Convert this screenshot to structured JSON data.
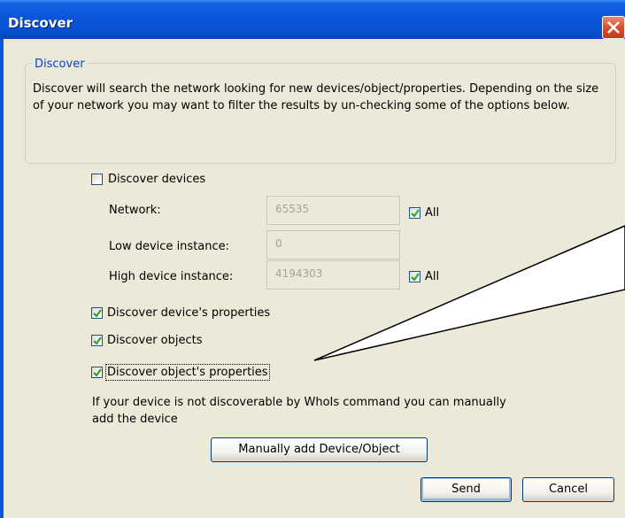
{
  "window": {
    "title": "Discover"
  },
  "group": {
    "legend": "Discover",
    "description": "Discover will search the network looking for new devices/object/properties. Depending on the size of your network you may want to filter the results by un-checking some of the options below."
  },
  "options": {
    "discover_devices": {
      "label": "Discover devices",
      "checked": false
    },
    "network": {
      "label": "Network:",
      "value": "65535",
      "all_label": "All",
      "all_checked": true
    },
    "low_instance": {
      "label": "Low device instance:",
      "value": "0"
    },
    "high_instance": {
      "label": "High device instance:",
      "value": "4194303",
      "all_label": "All",
      "all_checked": true
    },
    "device_properties": {
      "label": "Discover device's properties",
      "checked": true
    },
    "objects": {
      "label": "Discover objects",
      "checked": true
    },
    "object_properties": {
      "label": "Discover object's properties",
      "checked": true
    }
  },
  "manual": {
    "note_line1": "If your device is not discoverable by WhoIs command you can manually",
    "note_line2": "add the device",
    "button_label": "Manually add Device/Object"
  },
  "footer": {
    "send_label": "Send",
    "cancel_label": "Cancel"
  },
  "colors": {
    "titlebar": "#0a55d8",
    "dialog_bg": "#ece9d8",
    "legend_text": "#0046d5",
    "check_mark": "#21a121"
  }
}
